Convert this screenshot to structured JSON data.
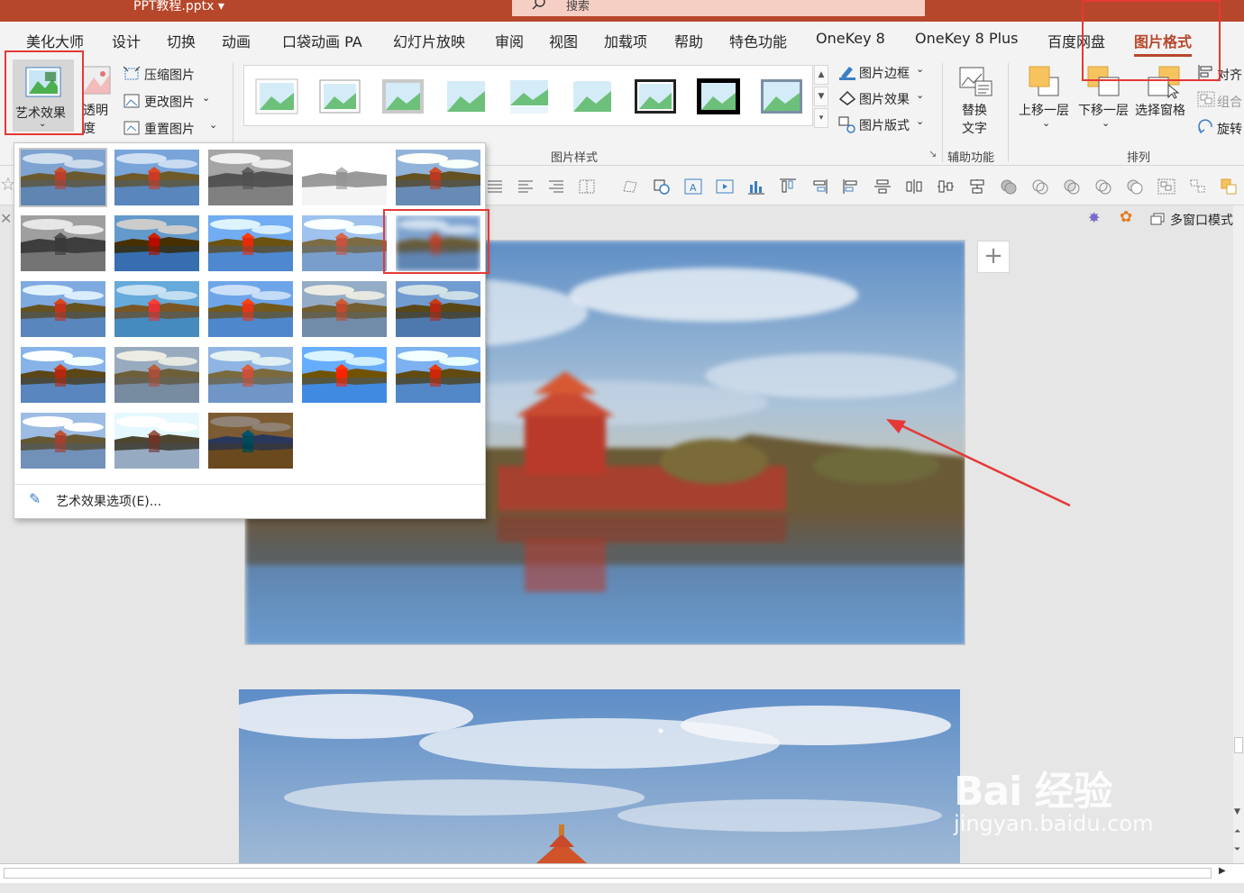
{
  "titlebar": {
    "filename": "PPT教程.pptx ▾",
    "search_placeholder": "搜索"
  },
  "tabs": [
    "美化大师",
    "设计",
    "切换",
    "动画",
    "口袋动画 PA",
    "幻灯片放映",
    "审阅",
    "视图",
    "加载项",
    "帮助",
    "特色功能",
    "OneKey 8",
    "OneKey 8 Plus",
    "百度网盘",
    "图片格式"
  ],
  "active_tab": "图片格式",
  "ribbon": {
    "art_effects": "艺术效果",
    "transparency_1": "透明",
    "transparency_2": "度",
    "compress": "压缩图片",
    "change": "更改图片",
    "reset": "重置图片",
    "picture_styles_label": "图片样式",
    "border": "图片边框",
    "effects": "图片效果",
    "layout": "图片版式",
    "alt_text_1": "替换",
    "alt_text_2": "文字",
    "accessibility_label": "辅助功能",
    "bring_forward": "上移一层",
    "send_backward": "下移一层",
    "selection_pane": "选择窗格",
    "align": "对齐",
    "group": "组合",
    "rotate": "旋转",
    "arrange_label": "排列"
  },
  "panel": {
    "multi_window": "多窗口模式"
  },
  "dropdown": {
    "options_label": "艺术效果选项(E)..."
  },
  "watermark": {
    "brand": "Bai 经验",
    "url": "jingyan.baidu.com"
  },
  "colors": {
    "accent": "#b7472a",
    "highlight": "#e53935",
    "arrow": "#e53935"
  }
}
